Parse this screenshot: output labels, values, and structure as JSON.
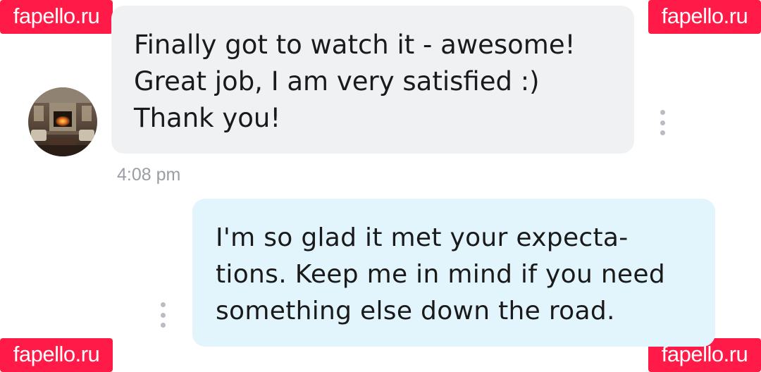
{
  "watermark": {
    "text": "fapello.ru",
    "color": "#ff1a47"
  },
  "conversation": {
    "incoming": {
      "avatar": "fireplace-room-avatar",
      "lines": [
        "Finally got to watch it - awesome!",
        "Great job, I am very satisfied :)",
        "Thank you!"
      ],
      "options_icon": "vertical-dots-icon",
      "bubble_color": "#f0f1f3"
    },
    "timestamp": "4:08 pm",
    "outgoing": {
      "lines": [
        "I'm so glad it met your expecta-",
        "tions. Keep me in mind if you need",
        "something else down the road."
      ],
      "options_icon": "vertical-dots-icon",
      "bubble_color": "#e2f4fc"
    }
  }
}
